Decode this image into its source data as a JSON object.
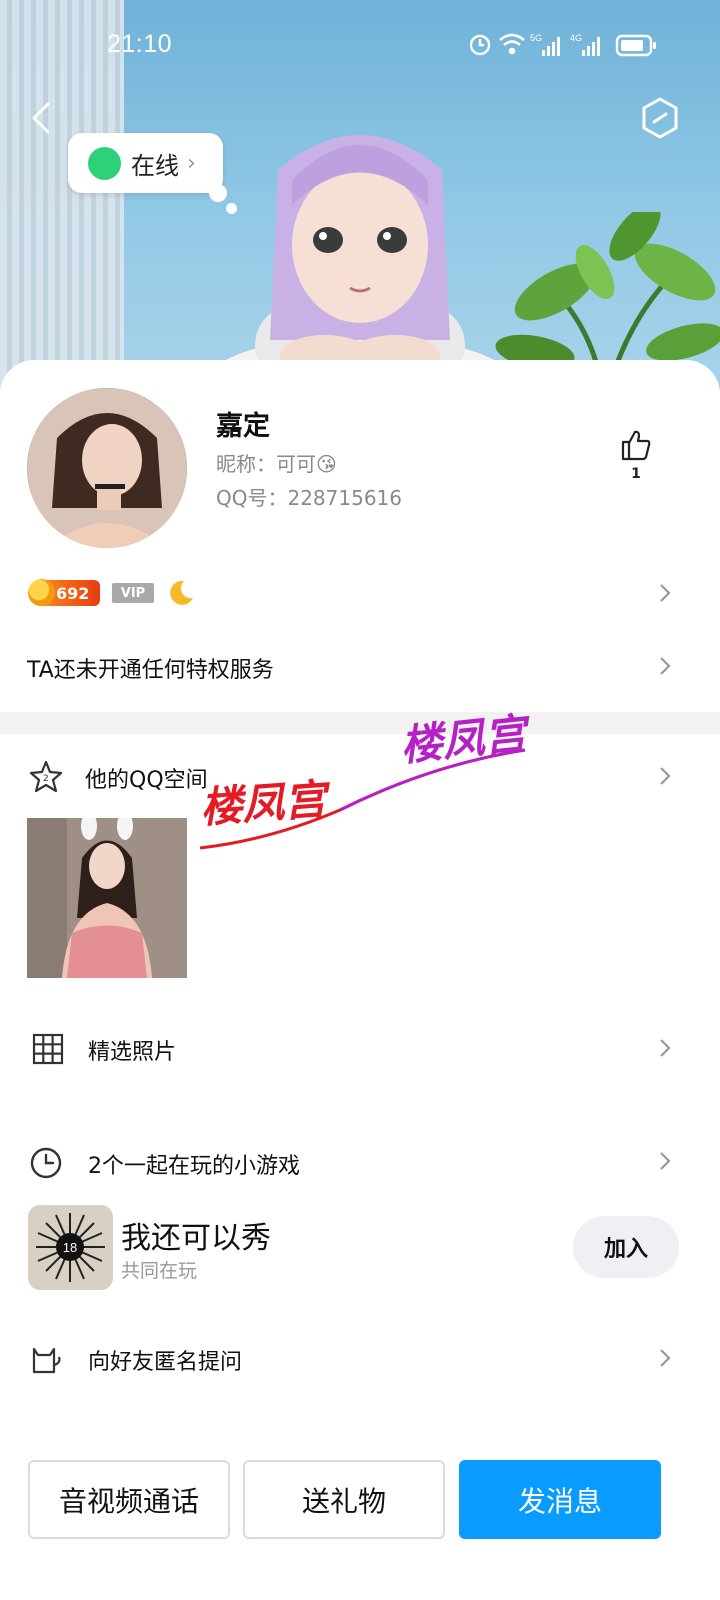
{
  "status_bar": {
    "time": "21:10",
    "net1": "5G",
    "net2": "4G"
  },
  "presence": {
    "label": "在线"
  },
  "profile": {
    "name": "嘉定",
    "nickname": "昵称：可可😘",
    "qq_number": "QQ号：228715616",
    "likes": "1",
    "level_points": "692",
    "vip_label": "VIP"
  },
  "privilege": {
    "text": "TA还未开通任何特权服务"
  },
  "qzone": {
    "title": "他的QQ空间"
  },
  "watermarks": [
    "楼凤宫",
    "楼凤宫"
  ],
  "photos": {
    "title": "精选照片"
  },
  "games": {
    "title": "2个一起在玩的小游戏",
    "items": [
      {
        "name": "我还可以秀",
        "subtitle": "共同在玩",
        "badge": "18",
        "button": "加入"
      }
    ]
  },
  "anonymous": {
    "title": "向好友匿名提问"
  },
  "actions": {
    "call": "音视频通话",
    "gift": "送礼物",
    "message": "发消息"
  },
  "colors": {
    "primary": "#0a9bff",
    "online": "#2ed17a",
    "watermark_red": "#e41b24",
    "watermark_purple": "#b521c6"
  }
}
